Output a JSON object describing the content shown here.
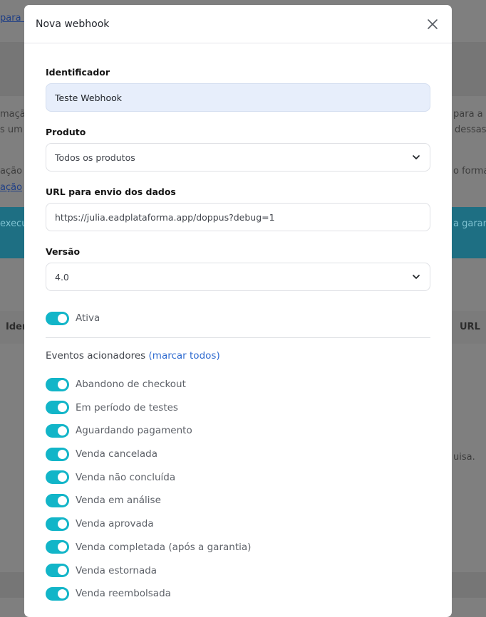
{
  "background": {
    "link_top": "para o",
    "line1_left": "mação",
    "line1_right": "para a s",
    "line2_left": "s um o",
    "line2_right": "dessas",
    "line3_left": "ação n",
    "line3_right": "o forma",
    "line4_link": "ação",
    "banner_left": "execu",
    "banner_right": "a garan",
    "table_col_left": "Iden",
    "table_col_right": "URL",
    "empty_right": "uisa."
  },
  "modal": {
    "title": "Nova webhook",
    "identifier": {
      "label": "Identificador",
      "value": "Teste Webhook"
    },
    "product": {
      "label": "Produto",
      "value": "Todos os produtos"
    },
    "url": {
      "label": "URL para envio dos dados",
      "value": "https://julia.eadplataforma.app/doppus?debug=1"
    },
    "version": {
      "label": "Versão",
      "value": "4.0"
    },
    "active": {
      "label": "Ativa",
      "checked": true
    },
    "events": {
      "title": "Eventos acionadores",
      "open_paren": "(",
      "mark_all": "marcar todos",
      "close_paren": ")",
      "items": [
        {
          "label": "Abandono de checkout",
          "checked": true
        },
        {
          "label": "Em período de testes",
          "checked": true
        },
        {
          "label": "Aguardando pagamento",
          "checked": true
        },
        {
          "label": "Venda cancelada",
          "checked": true
        },
        {
          "label": "Venda não concluída",
          "checked": true
        },
        {
          "label": "Venda em análise",
          "checked": true
        },
        {
          "label": "Venda aprovada",
          "checked": true
        },
        {
          "label": "Venda completada (após a garantia)",
          "checked": true
        },
        {
          "label": "Venda estornada",
          "checked": true
        },
        {
          "label": "Venda reembolsada",
          "checked": true
        }
      ]
    }
  },
  "colors": {
    "accent": "#12b5c8",
    "link": "#2f6bd0",
    "overlay": "#7f7f7f",
    "banner": "#1e6f83"
  }
}
